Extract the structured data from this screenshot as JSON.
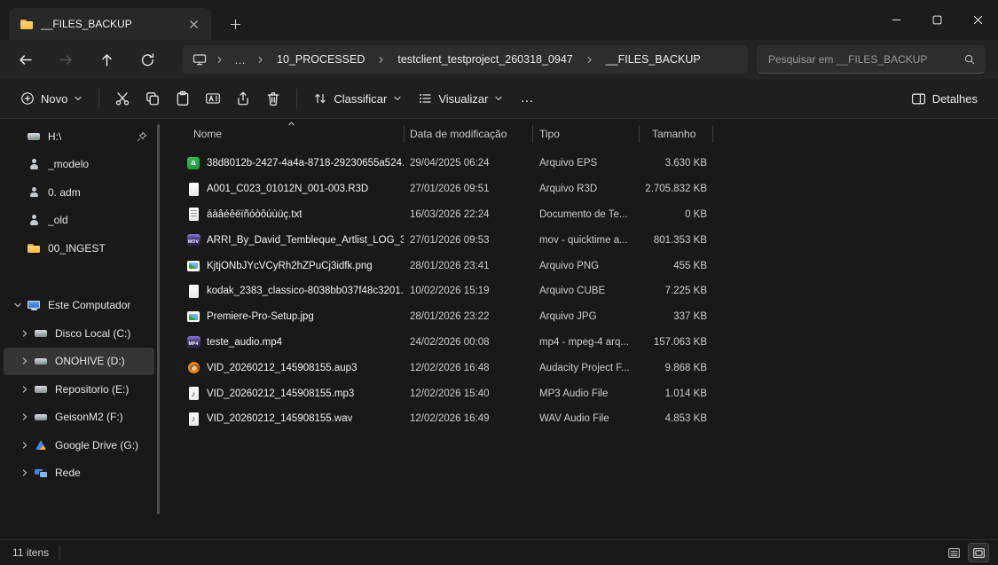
{
  "titlebar": {
    "tab_title": "__FILES_BACKUP"
  },
  "navbar": {
    "breadcrumb_overflow": "…",
    "breadcrumb": [
      "10_PROCESSED",
      "testclient_testproject_260318_0947",
      "__FILES_BACKUP"
    ],
    "search_placeholder": "Pesquisar em __FILES_BACKUP"
  },
  "toolbar": {
    "new": "Novo",
    "sort": "Classificar",
    "view": "Visualizar",
    "more": "…",
    "details": "Detalhes"
  },
  "sidebar": {
    "pinned": [
      {
        "label": "H:\\",
        "icon": "drive"
      },
      {
        "label": "_modelo",
        "icon": "user"
      },
      {
        "label": "0. adm",
        "icon": "user"
      },
      {
        "label": "_old",
        "icon": "user"
      },
      {
        "label": "00_INGEST",
        "icon": "folder"
      }
    ],
    "tree_root": {
      "label": "Este Computador",
      "icon": "computer"
    },
    "tree": [
      {
        "label": "Disco Local (C:)",
        "icon": "drive"
      },
      {
        "label": "ONOHIVE (D:)",
        "icon": "drive"
      },
      {
        "label": "Repositorio (E:)",
        "icon": "drive"
      },
      {
        "label": "GeisonM2 (F:)",
        "icon": "drive"
      },
      {
        "label": "Google Drive (G:)",
        "icon": "gdrive"
      },
      {
        "label": "Rede",
        "icon": "network"
      }
    ]
  },
  "filelist": {
    "columns": {
      "name": "Nome",
      "modified": "Data de modificação",
      "type": "Tipo",
      "size": "Tamanho"
    },
    "rows": [
      {
        "icon": "eps",
        "name": "38d8012b-2427-4a4a-8718-29230655a524...",
        "modified": "29/04/2025 06:24",
        "type": "Arquivo EPS",
        "size": "3.630 KB"
      },
      {
        "icon": "r3d",
        "name": "A001_C023_01012N_001-003.R3D",
        "modified": "27/01/2026 09:51",
        "type": "Arquivo R3D",
        "size": "2.705.832 KB"
      },
      {
        "icon": "txt",
        "name": "áàâéêëïñóòôúùüç.txt",
        "modified": "16/03/2026 22:24",
        "type": "Documento de Te...",
        "size": "0 KB"
      },
      {
        "icon": "mov",
        "name": "ARRI_By_David_Tembleque_Artlist_LOG_3...",
        "modified": "27/01/2026 09:53",
        "type": "mov - quicktime a...",
        "size": "801.353 KB"
      },
      {
        "icon": "png",
        "name": "KjtjONbJYcVCyRh2hZPuCj3idfk.png",
        "modified": "28/01/2026 23:41",
        "type": "Arquivo PNG",
        "size": "455 KB"
      },
      {
        "icon": "cube",
        "name": "kodak_2383_classico-8038bb037f48c3201...",
        "modified": "10/02/2026 15:19",
        "type": "Arquivo CUBE",
        "size": "7.225 KB"
      },
      {
        "icon": "jpg",
        "name": "Premiere-Pro-Setup.jpg",
        "modified": "28/01/2026 23:22",
        "type": "Arquivo JPG",
        "size": "337 KB"
      },
      {
        "icon": "mp4",
        "name": "teste_audio.mp4",
        "modified": "24/02/2026 00:08",
        "type": "mp4 - mpeg-4 arq...",
        "size": "157.063 KB"
      },
      {
        "icon": "aup3",
        "name": "VID_20260212_145908155.aup3",
        "modified": "12/02/2026 16:48",
        "type": "Audacity Project F...",
        "size": "9.868 KB"
      },
      {
        "icon": "mp3",
        "name": "VID_20260212_145908155.mp3",
        "modified": "12/02/2026 15:40",
        "type": "MP3 Audio File",
        "size": "1.014 KB"
      },
      {
        "icon": "wav",
        "name": "VID_20260212_145908155.wav",
        "modified": "12/02/2026 16:49",
        "type": "WAV Audio File",
        "size": "4.853 KB"
      }
    ]
  },
  "statusbar": {
    "count": "11 itens"
  }
}
